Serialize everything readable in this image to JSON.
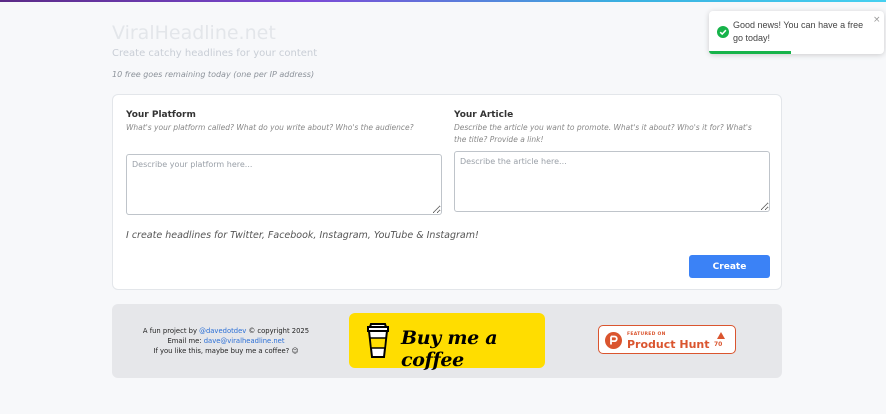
{
  "header": {
    "title": "ViralHeadline.net",
    "tagline": "Create catchy headlines for your content",
    "remaining": "10 free goes remaining today (one per IP address)"
  },
  "form": {
    "platform": {
      "label": "Your Platform",
      "hint": "What's your platform called? What do you write about? Who's the audience?",
      "placeholder": "Describe your platform here..."
    },
    "article": {
      "label": "Your Article",
      "hint": "Describe the article you want to promote. What's it about? Who's it for? What's the title? Provide a link!",
      "placeholder": "Describe the article here..."
    },
    "note": "I create headlines for Twitter, Facebook, Instagram, YouTube & Instagram!",
    "create_label": "Create"
  },
  "footer": {
    "line1_prefix": "A fun project by ",
    "author_handle": "@davedotdev",
    "line1_suffix": " © copyright 2025",
    "email_label": "Email me: ",
    "email": "dave@viralheadline.net",
    "line3": "If you like this, maybe buy me a coffee? 😉",
    "bmc_label": "Buy me a coffee",
    "ph_featured": "FEATURED ON",
    "ph_name": "Product Hunt",
    "ph_votes": "70"
  },
  "toast": {
    "message": "Good news! You can have a free go today!",
    "close": "×",
    "progress": 0.47
  },
  "colors": {
    "accent": "#3b82f6",
    "success": "#16b34a",
    "producthunt": "#da552f",
    "bmc_yellow": "#ffdd00"
  }
}
